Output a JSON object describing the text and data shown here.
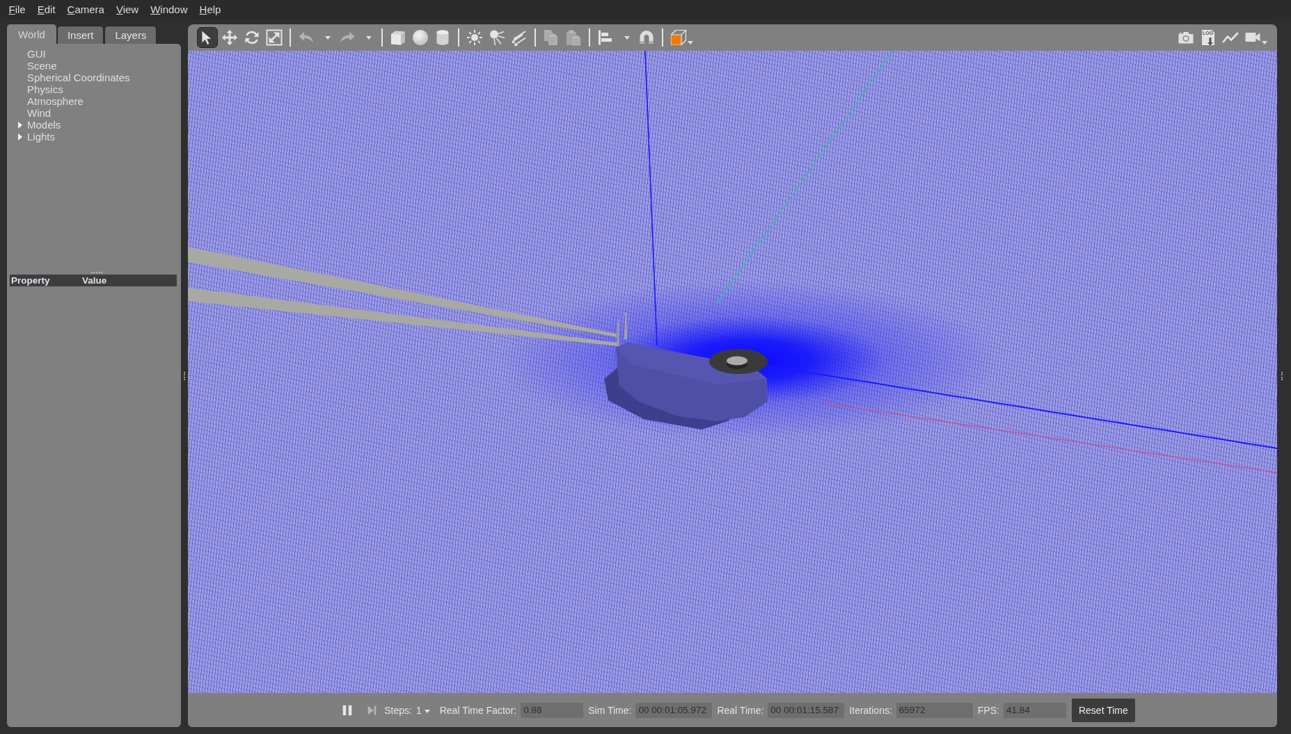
{
  "menu_bar": [
    "File",
    "Edit",
    "Camera",
    "View",
    "Window",
    "Help"
  ],
  "tabs": [
    {
      "label": "World",
      "selected": true
    },
    {
      "label": "Insert",
      "selected": false
    },
    {
      "label": "Layers",
      "selected": false
    }
  ],
  "world_tree": [
    {
      "label": "GUI",
      "kind": "leaf"
    },
    {
      "label": "Scene",
      "kind": "leaf"
    },
    {
      "label": "Spherical Coordinates",
      "kind": "leaf"
    },
    {
      "label": "Physics",
      "kind": "leaf"
    },
    {
      "label": "Atmosphere",
      "kind": "leaf"
    },
    {
      "label": "Wind",
      "kind": "leaf"
    },
    {
      "label": "Models",
      "kind": "branch",
      "expanded": false
    },
    {
      "label": "Lights",
      "kind": "branch",
      "expanded": false
    }
  ],
  "property_table": {
    "columns": [
      "Property",
      "Value"
    ]
  },
  "toolbar": {
    "groups": [
      {
        "tools": [
          {
            "kind": "select",
            "selected": true,
            "disabled": false,
            "dropdown": false
          },
          {
            "kind": "translate",
            "selected": false,
            "disabled": false,
            "dropdown": false
          },
          {
            "kind": "rotate",
            "selected": false,
            "disabled": false,
            "dropdown": false
          },
          {
            "kind": "scale",
            "selected": false,
            "disabled": false,
            "dropdown": false
          }
        ]
      },
      {
        "tools": [
          {
            "kind": "undo",
            "selected": false,
            "disabled": true,
            "dropdown": true
          },
          {
            "kind": "redo",
            "selected": false,
            "disabled": true,
            "dropdown": true
          }
        ]
      },
      {
        "tools": [
          {
            "kind": "box",
            "selected": false,
            "disabled": false,
            "dropdown": false
          },
          {
            "kind": "sphere",
            "selected": false,
            "disabled": false,
            "dropdown": false
          },
          {
            "kind": "cylinder",
            "selected": false,
            "disabled": false,
            "dropdown": false
          }
        ]
      },
      {
        "tools": [
          {
            "kind": "point_light",
            "selected": false,
            "disabled": false,
            "dropdown": false
          },
          {
            "kind": "spot_light",
            "selected": false,
            "disabled": false,
            "dropdown": false
          },
          {
            "kind": "directional_light",
            "selected": false,
            "disabled": false,
            "dropdown": false
          }
        ]
      },
      {
        "tools": [
          {
            "kind": "copy",
            "selected": false,
            "disabled": true,
            "dropdown": false
          },
          {
            "kind": "paste",
            "selected": false,
            "disabled": true,
            "dropdown": false
          }
        ]
      },
      {
        "tools": [
          {
            "kind": "align",
            "selected": false,
            "disabled": false,
            "dropdown": true
          },
          {
            "kind": "snap",
            "selected": false,
            "disabled": false,
            "dropdown": false
          }
        ]
      },
      {
        "tools": [
          {
            "kind": "view_angle",
            "selected": false,
            "disabled": false,
            "dropdown": true
          }
        ]
      }
    ],
    "right_tools": [
      {
        "kind": "screenshot",
        "disabled": false,
        "dropdown": false
      },
      {
        "kind": "log",
        "text": "LOG",
        "disabled": false,
        "dropdown": false
      },
      {
        "kind": "plot",
        "disabled": false,
        "dropdown": false
      },
      {
        "kind": "record",
        "disabled": false,
        "dropdown": true
      }
    ]
  },
  "bottom_bar": {
    "running": true,
    "step_disabled": true,
    "steps": {
      "label": "Steps:",
      "value": "1"
    },
    "stats": [
      {
        "label": "Real Time Factor:",
        "value": "0.88"
      },
      {
        "label": "Sim Time:",
        "value": "00 00:01:05.972"
      },
      {
        "label": "Real Time:",
        "value": "00 00:01:15.587"
      },
      {
        "label": "Iterations:",
        "value": "65972"
      },
      {
        "label": "FPS:",
        "value": "41.84"
      }
    ],
    "reset_button": "Reset Time"
  }
}
